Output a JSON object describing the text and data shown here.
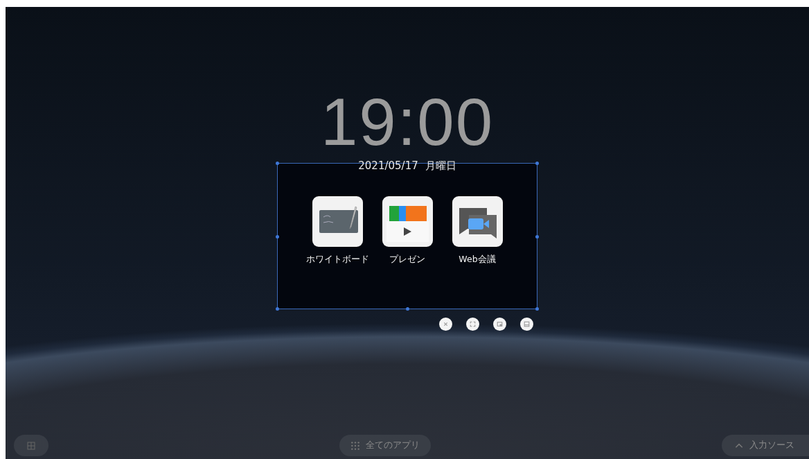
{
  "clock": {
    "time": "19:00",
    "date": "2021/05/17",
    "weekday": "月曜日"
  },
  "widget": {
    "selected": true,
    "apps": [
      {
        "label": "ホワイトボード",
        "kind": "whiteboard"
      },
      {
        "label": "プレゼン",
        "kind": "presentation"
      },
      {
        "label": "Web会議",
        "kind": "meeting"
      }
    ],
    "controls": [
      {
        "kind": "close"
      },
      {
        "kind": "fullscreen"
      },
      {
        "kind": "window"
      },
      {
        "kind": "minimize"
      }
    ]
  },
  "bottom_bar": {
    "all_apps": "全てのアプリ",
    "input_source": "入力ソース"
  }
}
